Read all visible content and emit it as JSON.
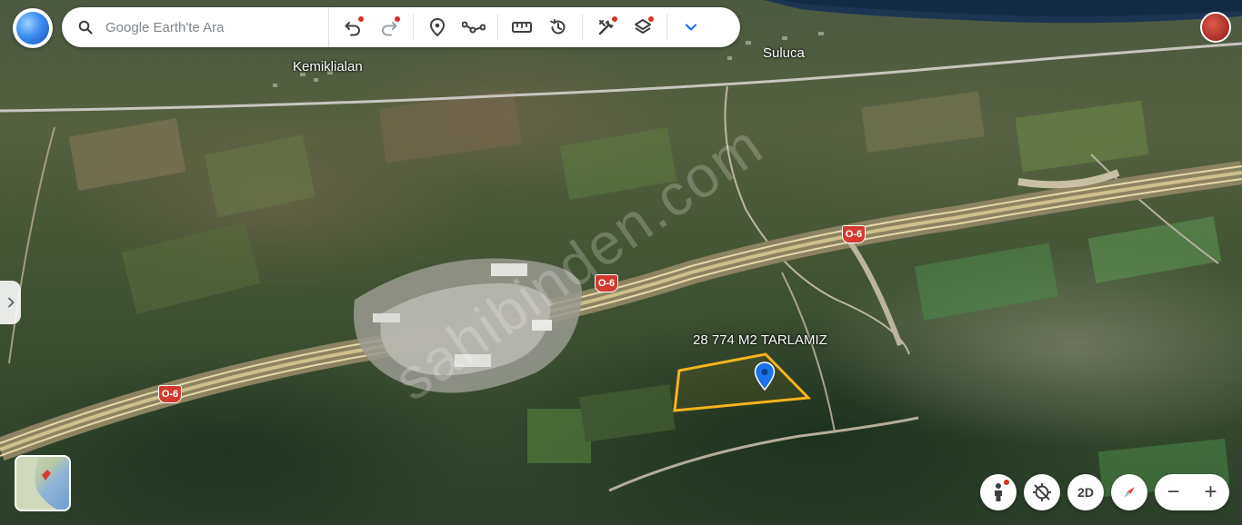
{
  "search": {
    "placeholder": "Google Earth'te Ara"
  },
  "toolbar": {
    "icons": [
      "undo-icon",
      "redo-icon",
      "placemark-icon",
      "path-icon",
      "measure-icon",
      "history-icon",
      "tools-icon",
      "layers-icon",
      "chevron-down-icon"
    ],
    "accent": "#1a73e8",
    "notification_dot": "#d93025"
  },
  "map": {
    "places": {
      "kemiklialan": "Kemiklialan",
      "suluca": "Suluca"
    },
    "road_shields": [
      "O-6",
      "O-6",
      "O-6"
    ],
    "placemark": {
      "label": "28 774 M2 TARLAMIZ",
      "outline_color": "#f5b51b",
      "pin_color": "#1a73e8"
    },
    "watermark": "sahibinden.com"
  },
  "controls": {
    "street_view": "street-view-icon",
    "north": "reset-tilt-icon",
    "view_mode": "2D",
    "compass": "compass-icon",
    "zoom_out": "−",
    "zoom_in": "+"
  }
}
